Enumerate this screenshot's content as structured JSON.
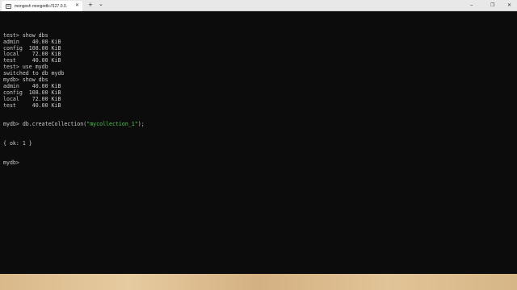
{
  "window": {
    "tab_title": "mongosh mongodb://127.0.0.",
    "tab_close_glyph": "✕",
    "new_tab_glyph": "+",
    "dropdown_glyph": "⌄",
    "minimize_glyph": "–",
    "maximize_glyph": "❐",
    "close_glyph": "✕"
  },
  "terminal": {
    "lines": [
      "test> show dbs",
      "admin    40.00 KiB",
      "config  108.00 KiB",
      "local    72.00 KiB",
      "test     40.00 KiB",
      "test> use mydb",
      "switched to db mydb",
      "mydb> show dbs",
      "admin    40.00 KiB",
      "config  108.00 KiB",
      "local    72.00 KiB",
      "test     40.00 KiB"
    ],
    "create_prefix": "mydb> db.createCollection(",
    "create_arg": "\"mycollection_1\"",
    "create_suffix": ");",
    "result_prefix": "{ ok: ",
    "result_value": "1",
    "result_suffix": " }",
    "prompt": "mydb> "
  },
  "colors": {
    "terminal_bg": "#0c0c0c",
    "terminal_text": "#cccccc",
    "string_green": "#4ec94e"
  }
}
